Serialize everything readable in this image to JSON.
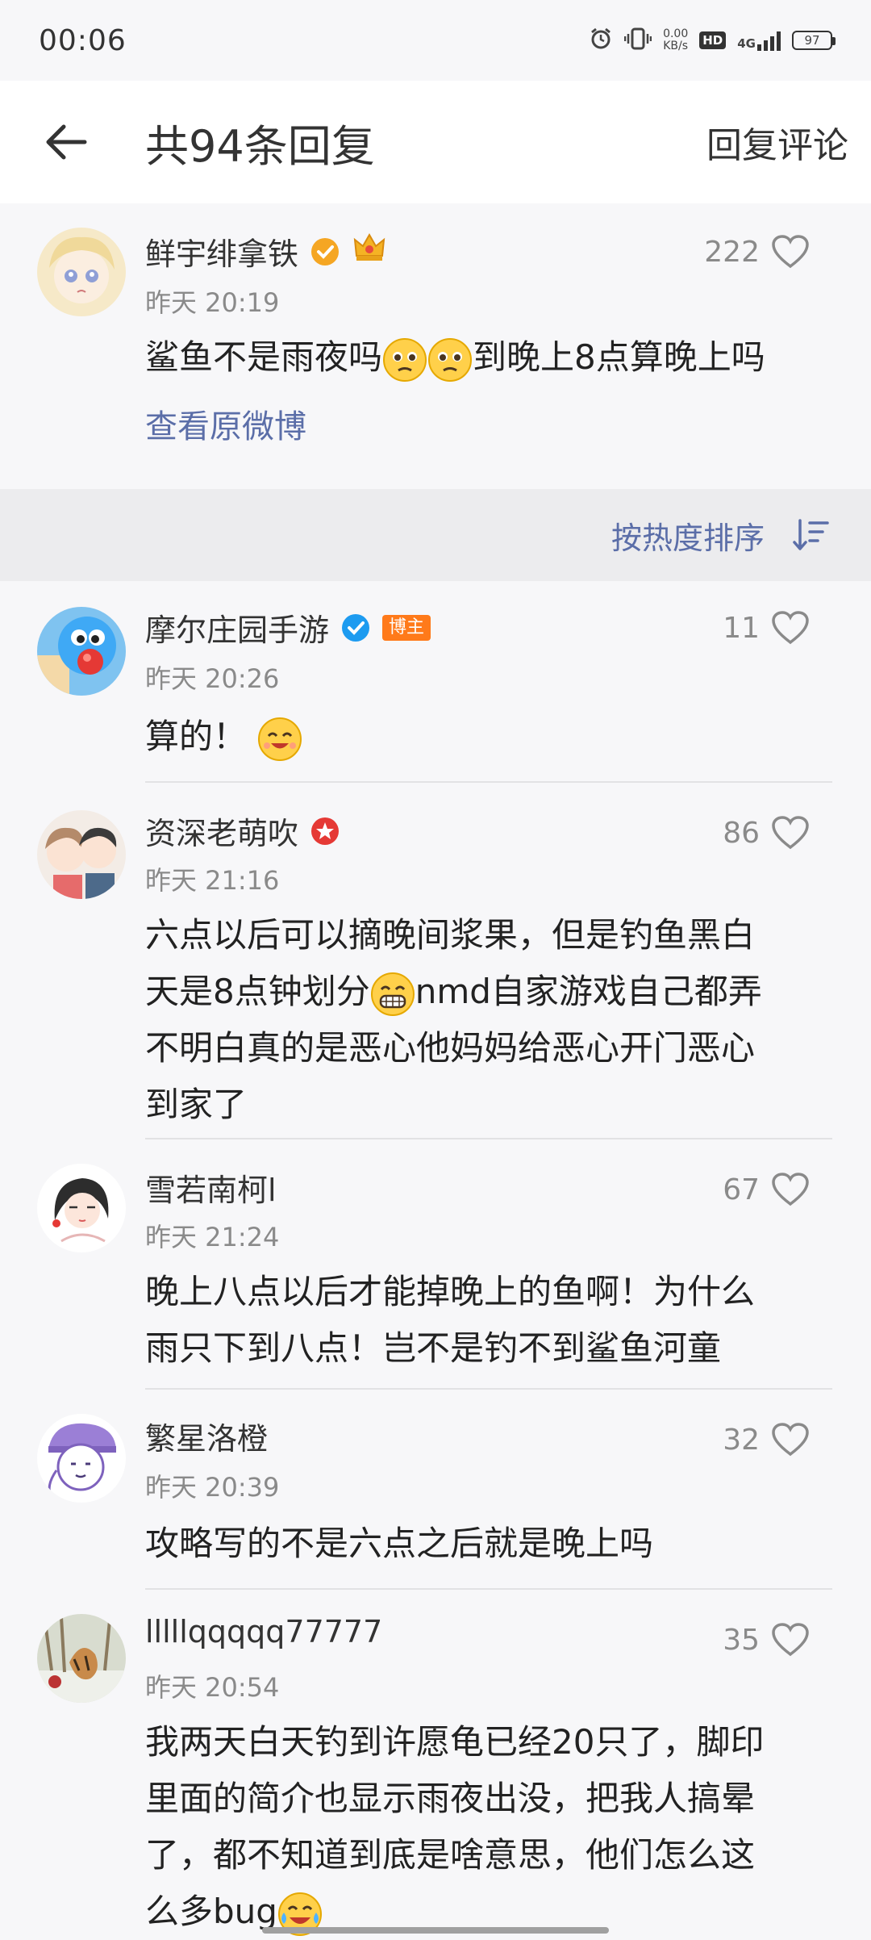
{
  "status_bar": {
    "time": "00:06",
    "net_speed_value": "0.00",
    "net_speed_unit": "KB/s",
    "hd": "HD",
    "network": "4G",
    "battery": "97"
  },
  "header": {
    "title": "共94条回复",
    "right_action": "回复评论"
  },
  "main_comment": {
    "username": "鲜宇绯拿铁",
    "time": "昨天 20:19",
    "likes": "222",
    "text_part1": "鲨鱼不是雨夜吗",
    "text_part2": "到晚上8点算晚上吗",
    "link": "查看原微博"
  },
  "sort": {
    "label": "按热度排序"
  },
  "replies": [
    {
      "username": "摩尔庄园手游",
      "tag": "博主",
      "time": "昨天 20:26",
      "likes": "11",
      "text": "算的！"
    },
    {
      "username": "资深老萌吹",
      "time": "昨天 21:16",
      "likes": "86",
      "line1": "六点以后可以摘晚间浆果，但是钓鱼黑白",
      "line2a": "天是8点钟划分",
      "line2b": "nmd自家游戏自己都弄",
      "line3": "不明白真的是恶心他妈妈给恶心开门恶心",
      "line4": "到家了"
    },
    {
      "username": "雪若南柯l",
      "time": "昨天 21:24",
      "likes": "67",
      "line1": "晚上八点以后才能掉晚上的鱼啊！为什么",
      "line2": "雨只下到八点！岂不是钓不到鲨鱼河童"
    },
    {
      "username": "繁星洛橙",
      "time": "昨天 20:39",
      "likes": "32",
      "text": "攻略写的不是六点之后就是晚上吗"
    },
    {
      "username": "lllllqqqqq77777",
      "time": "昨天 20:54",
      "likes": "35",
      "line1": "我两天白天钓到许愿龟已经20只了，脚印",
      "line2": "里面的简介也显示雨夜出没，把我人搞晕",
      "line3": "了，都不知道到底是啥意思，他们怎么这",
      "line4": "么多bug"
    }
  ],
  "colors": {
    "link": "#5b6ea8",
    "muted": "#8a8a8a",
    "verified_gold": "#f5a623",
    "verified_blue": "#1d9bf0",
    "blogger_tag": "#ff7a1a"
  }
}
